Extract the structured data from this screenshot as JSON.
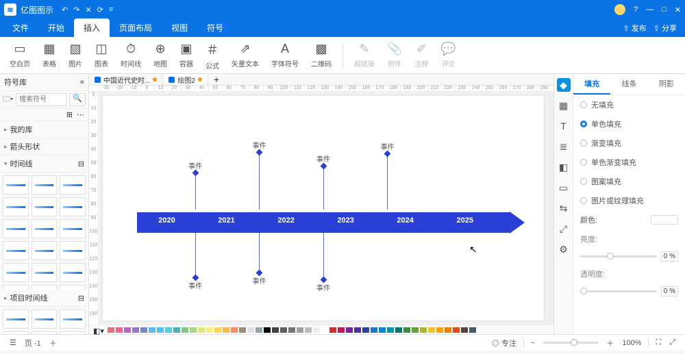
{
  "app": {
    "title": "亿图图示"
  },
  "qat": [
    "↶",
    "↷",
    "✕",
    "⟳",
    "≡"
  ],
  "winbtns": [
    "—",
    "□",
    "✕"
  ],
  "menubar": {
    "tabs": [
      "文件",
      "开始",
      "插入",
      "页面布局",
      "视图",
      "符号"
    ],
    "active": 2,
    "right": [
      "发布",
      "分享"
    ]
  },
  "ribbon": [
    {
      "icon": "▭",
      "label": "空白页"
    },
    {
      "icon": "▦",
      "label": "表格"
    },
    {
      "icon": "▧",
      "label": "图片"
    },
    {
      "icon": "◫",
      "label": "图表"
    },
    {
      "icon": "⏱",
      "label": "时间线"
    },
    {
      "icon": "⊕",
      "label": "地图"
    },
    {
      "icon": "▣",
      "label": "容器"
    },
    {
      "icon": "＃",
      "label": "公式"
    },
    {
      "icon": "⇗",
      "label": "矢量文本"
    },
    {
      "icon": "A",
      "label": "字体符号"
    },
    {
      "icon": "▩",
      "label": "二维码"
    },
    {
      "sep": true
    },
    {
      "icon": "✎",
      "label": "超链接",
      "disabled": true
    },
    {
      "icon": "📎",
      "label": "附件",
      "disabled": true
    },
    {
      "icon": "✐",
      "label": "注释",
      "disabled": true
    },
    {
      "icon": "💬",
      "label": "评论",
      "disabled": true
    }
  ],
  "leftpanel": {
    "header": "符号库",
    "search_placeholder": "搜索符号",
    "cats": [
      "我的库",
      "箭头形状"
    ],
    "open_cat": "时间线",
    "proj_cat": "项目时间线"
  },
  "doctabs": [
    {
      "label": "中国近代史时...",
      "dot": "#f59e0b"
    },
    {
      "label": "绘图2",
      "dot": "#f59e0b",
      "active": true
    }
  ],
  "ruler_ticks": [
    "-30",
    "-20",
    "-10",
    "0",
    "10",
    "20",
    "30",
    "40",
    "50",
    "60",
    "70",
    "80",
    "90",
    "100",
    "110",
    "120",
    "130",
    "140",
    "150",
    "160",
    "170",
    "180",
    "190",
    "200",
    "210",
    "220",
    "230",
    "240",
    "250",
    "260",
    "270",
    "280",
    "290"
  ],
  "vruler_ticks": [
    "0",
    "10",
    "20",
    "30",
    "40",
    "50",
    "60",
    "70",
    "80",
    "90",
    "100",
    "110",
    "120",
    "130",
    "140",
    "150",
    "160"
  ],
  "timeline": {
    "years": [
      "2020",
      "2021",
      "2022",
      "2023",
      "2024",
      "2025"
    ],
    "events_top": [
      {
        "pos": 18,
        "label": "事件",
        "len": 50
      },
      {
        "pos": 34,
        "label": "事件",
        "len": 80
      },
      {
        "pos": 50,
        "label": "事件",
        "len": 60
      },
      {
        "pos": 66,
        "label": "事件",
        "len": 78
      }
    ],
    "events_bot": [
      {
        "pos": 18,
        "label": "事件",
        "len": 62
      },
      {
        "pos": 34,
        "label": "事件",
        "len": 55
      },
      {
        "pos": 50,
        "label": "事件",
        "len": 65
      }
    ]
  },
  "colors": [
    "#e57373",
    "#f06292",
    "#ba68c8",
    "#9575cd",
    "#7986cb",
    "#64b5f6",
    "#4fc3f7",
    "#4dd0e1",
    "#4db6ac",
    "#81c784",
    "#aed581",
    "#dce775",
    "#fff176",
    "#ffd54f",
    "#ffb74d",
    "#ff8a65",
    "#a1887f",
    "#e0e0e0",
    "#90a4ae",
    "#000",
    "#424242",
    "#616161",
    "#757575",
    "#9e9e9e",
    "#bdbdbd",
    "#eee",
    "#fff",
    "#d32f2f",
    "#c2185b",
    "#7b1fa2",
    "#512da8",
    "#303f9f",
    "#1976d2",
    "#0288d1",
    "#0097a7",
    "#00796b",
    "#388e3c",
    "#689f38",
    "#afb42b",
    "#fbc02d",
    "#ffa000",
    "#f57c00",
    "#e64a19",
    "#5d4037",
    "#455a64"
  ],
  "righttool": [
    "◆",
    "▦",
    "T",
    "≣",
    "◧",
    "▭",
    "⇆",
    "⤢",
    "⚙"
  ],
  "rightpanel": {
    "tabs": [
      "填充",
      "线条",
      "阴影"
    ],
    "active": 0,
    "fill_opts": [
      "无填充",
      "单色填充",
      "渐变填充",
      "单色渐变填充",
      "图案填充",
      "图片或纹理填充"
    ],
    "fill_active": 1,
    "color_label": "颜色:",
    "brightness": "亮度:",
    "opacity": "透明度:",
    "pct": "0 %"
  },
  "status": {
    "page": "页 -1",
    "focus": "专注",
    "zoom": "100%"
  }
}
